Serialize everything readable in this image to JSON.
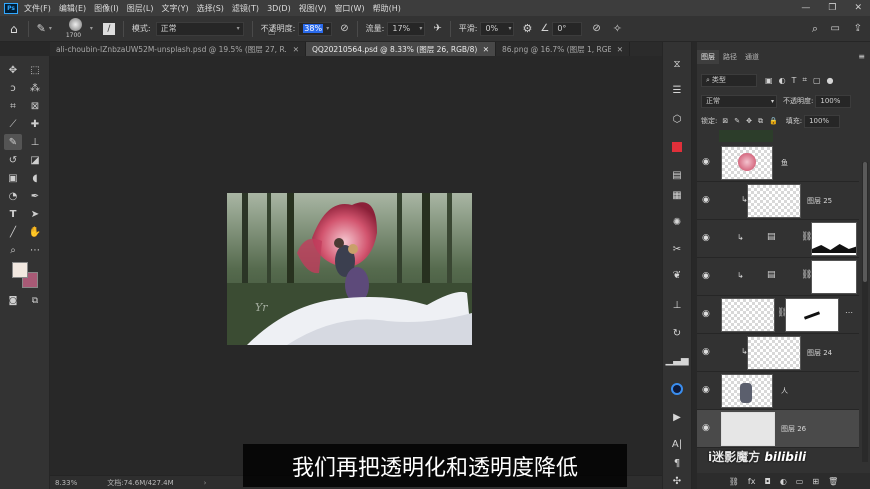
{
  "menubar": {
    "logo": "Ps",
    "items": [
      "文件(F)",
      "编辑(E)",
      "图像(I)",
      "图层(L)",
      "文字(Y)",
      "选择(S)",
      "滤镜(T)",
      "3D(D)",
      "视图(V)",
      "窗口(W)",
      "帮助(H)"
    ],
    "window_controls": [
      "—",
      "❐",
      "✕"
    ]
  },
  "options": {
    "brush_size": "1700",
    "mode_label": "模式:",
    "mode_value": "正常",
    "opacity_label": "不透明度:",
    "opacity_value": "38%",
    "flow_label": "流量:",
    "flow_value": "17%",
    "smoothing_label": "平滑:",
    "smoothing_value": "0%",
    "angle_value": "0°"
  },
  "tabs": [
    {
      "label": "ali-choubin-IZnbzaUW52M-unsplash.psd @ 19.5% (图层 27, R...",
      "close": "✕",
      "active": false
    },
    {
      "label": "QQ20210564.psd @ 8.33% (图层 26, RGB/8) *",
      "close": "✕",
      "active": true
    },
    {
      "label": "86.png @ 16.7% (图层 1, RGB...",
      "close": "✕",
      "active": false
    }
  ],
  "toolbar": {
    "tools": [
      "move-icon",
      "marquee-icon",
      "lasso-icon",
      "magic-wand-icon",
      "crop-icon",
      "frame-icon",
      "eyedropper-icon",
      "healing-icon",
      "brush-icon",
      "stamp-icon",
      "history-brush-icon",
      "eraser-icon",
      "gradient-icon",
      "blur-icon",
      "dodge-icon",
      "pen-icon",
      "type-icon",
      "path-select-icon",
      "line-icon",
      "hand-icon",
      "zoom-icon",
      "more-icon"
    ],
    "foreground_color": "#f2e8e0",
    "background_color": "#a85a76"
  },
  "status": {
    "zoom": "8.33%",
    "doc_size": "文档:74.6M/427.4M"
  },
  "layers_panel": {
    "tabs": [
      "图层",
      "路径",
      "通道"
    ],
    "filter_label": "类型",
    "blend_mode": "正常",
    "opacity_label": "不透明度:",
    "opacity_value": "100%",
    "lock_label": "锁定:",
    "fill_label": "填充:",
    "fill_value": "100%",
    "layers": [
      {
        "name": "鱼",
        "visible": true
      },
      {
        "name": "图层 25",
        "visible": true
      },
      {
        "name": "",
        "visible": true
      },
      {
        "name": "",
        "visible": true
      },
      {
        "name": "",
        "visible": true
      },
      {
        "name": "图层 24",
        "visible": true
      },
      {
        "name": "人",
        "visible": true
      },
      {
        "name": "图层 26",
        "visible": true
      }
    ],
    "bottom_icons": [
      "link-icon",
      "fx-icon",
      "mask-icon",
      "adjustment-icon",
      "group-icon",
      "new-layer-icon",
      "trash-icon"
    ]
  },
  "subtitle": "我们再把透明化和透明度降低",
  "watermark": {
    "prefix": "i迷影魔方",
    "brand": "bilibili"
  }
}
